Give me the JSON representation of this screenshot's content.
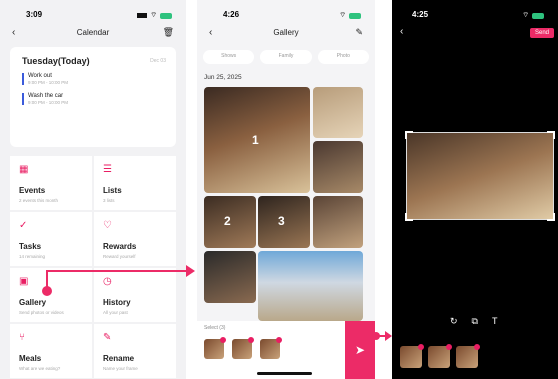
{
  "screen1": {
    "time": "3:09",
    "title": "Calendar",
    "today_title": "Tuesday(Today)",
    "today_tag": "Dec 03",
    "events": [
      {
        "name": "Work out",
        "time": "9:00 PM - 10:00 PM"
      },
      {
        "name": "Wash the car",
        "time": "9:00 PM - 10:00 PM"
      }
    ],
    "tiles": [
      {
        "name": "Events",
        "sub": "2 events this month",
        "icon": "calendar-icon"
      },
      {
        "name": "Lists",
        "sub": "3 lists",
        "icon": "list-icon"
      },
      {
        "name": "Tasks",
        "sub": "14 remaining",
        "icon": "tasks-icon"
      },
      {
        "name": "Rewards",
        "sub": "Reward yourself",
        "icon": "rewards-icon"
      },
      {
        "name": "Gallery",
        "sub": "Send photos or videos",
        "icon": "gallery-icon"
      },
      {
        "name": "History",
        "sub": "All your past",
        "icon": "history-icon"
      },
      {
        "name": "Meals",
        "sub": "What are we eating?",
        "icon": "meals-icon"
      },
      {
        "name": "Rename",
        "sub": "Name your frame",
        "icon": "rename-icon"
      }
    ]
  },
  "screen2": {
    "time": "4:26",
    "title": "Gallery",
    "filters": [
      "Shows",
      "Family",
      "Photo"
    ],
    "date": "Jun 25, 2025",
    "photo_numbers": [
      "1",
      "2",
      "3"
    ],
    "selected_label": "Select (3)"
  },
  "screen3": {
    "time": "4:25",
    "send_label": "Send"
  },
  "colors": {
    "accent": "#ec2b67",
    "event_bar": "#3b5bdb"
  }
}
